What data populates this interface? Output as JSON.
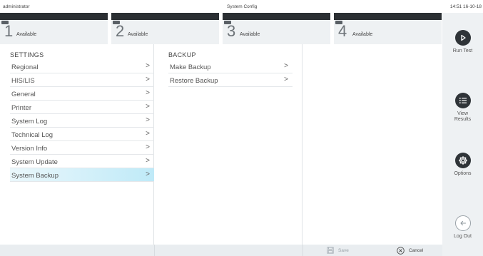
{
  "topbar": {
    "user": "administrator",
    "title": "System Config",
    "clock": "14:51 16-10-18"
  },
  "modules": [
    {
      "number": "1",
      "status": "Available"
    },
    {
      "number": "2",
      "status": "Available"
    },
    {
      "number": "3",
      "status": "Available"
    },
    {
      "number": "4",
      "status": "Available"
    }
  ],
  "settings": {
    "heading": "SETTINGS",
    "items": [
      {
        "label": "Regional"
      },
      {
        "label": "HIS/LIS"
      },
      {
        "label": "General"
      },
      {
        "label": "Printer"
      },
      {
        "label": "System Log"
      },
      {
        "label": "Technical Log"
      },
      {
        "label": "Version Info"
      },
      {
        "label": "System Update"
      },
      {
        "label": "System Backup",
        "selected": true
      }
    ]
  },
  "backup": {
    "heading": "BACKUP",
    "items": [
      {
        "label": "Make Backup"
      },
      {
        "label": "Restore Backup"
      }
    ]
  },
  "sidebar": {
    "run_test": "Run Test",
    "view_results_line1": "View",
    "view_results_line2": "Results",
    "options": "Options",
    "log_out": "Log Out"
  },
  "bottom": {
    "save": "Save",
    "cancel": "Cancel"
  },
  "colors": {
    "selected_row": "#bfeaf8",
    "dark_button": "#2f3438",
    "module_strip": "#2b2f33"
  },
  "icons": {
    "run_test": "play-icon",
    "view_results": "list-icon",
    "options": "gear-icon",
    "log_out": "logout-arrow-icon",
    "save": "save-icon",
    "cancel": "close-circle-icon",
    "row": "chevron-right-icon"
  }
}
